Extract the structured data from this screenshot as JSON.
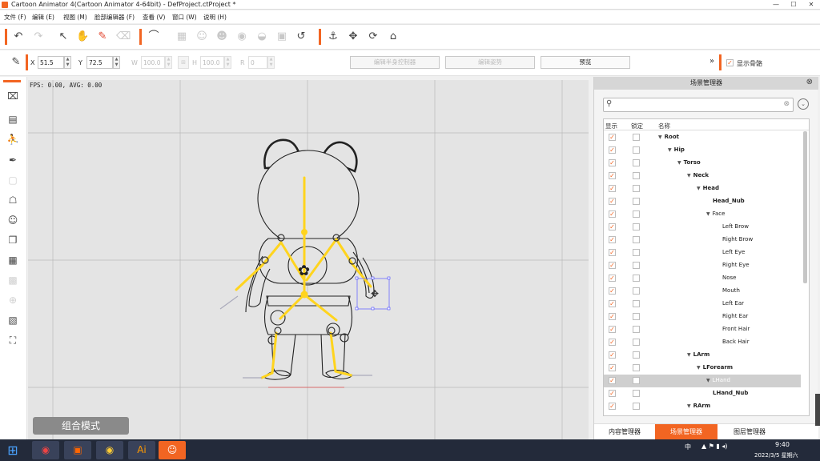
{
  "window": {
    "title": "Cartoon Animator 4(Cartoon Animator 4-64bit) - DefProject.ctProject *",
    "minimize": "—",
    "maximize": "☐",
    "close": "✕"
  },
  "menu": [
    "文件 (F)",
    "编辑 (E)",
    "视图 (M)",
    "脸部编辑器 (F)",
    "查看 (V)",
    "窗口 (W)",
    "说明 (H)"
  ],
  "toolbar2": {
    "x_label": "X",
    "x_value": "51.5",
    "y_label": "Y",
    "y_value": "72.5",
    "w_label": "W",
    "w_value": "100.0",
    "h_label": "H",
    "h_value": "100.0",
    "r_label": "R",
    "r_value": "0",
    "btn_edit_sprite": "编辑半身控制器",
    "btn_edit_pose": "编辑姿势",
    "btn_preview": "预览",
    "more": "»",
    "show_bones_label": "显示骨骼",
    "show_bones_checked": true
  },
  "viewport": {
    "fps_text": "FPS: 0.00, AVG: 0.00",
    "mode_button": "组合模式"
  },
  "scene_panel": {
    "title": "场景管理器",
    "search_placeholder": "",
    "col_show": "显示",
    "col_lock": "锁定",
    "col_name": "名称",
    "rows": [
      {
        "name": "Root",
        "depth": 0,
        "expanded": true,
        "bold": true
      },
      {
        "name": "Hip",
        "depth": 1,
        "expanded": true,
        "bold": true
      },
      {
        "name": "Torso",
        "depth": 2,
        "expanded": true,
        "bold": true
      },
      {
        "name": "Neck",
        "depth": 3,
        "expanded": true,
        "bold": true
      },
      {
        "name": "Head",
        "depth": 4,
        "expanded": true,
        "bold": true
      },
      {
        "name": "Head_Nub",
        "depth": 5,
        "expanded": false,
        "bold": true
      },
      {
        "name": "Face",
        "depth": 5,
        "expanded": true,
        "bold": false
      },
      {
        "name": "Left Brow",
        "depth": 6,
        "expanded": false,
        "bold": false
      },
      {
        "name": "Right Brow",
        "depth": 6,
        "expanded": false,
        "bold": false
      },
      {
        "name": "Left Eye",
        "depth": 6,
        "expanded": false,
        "bold": false
      },
      {
        "name": "Right Eye",
        "depth": 6,
        "expanded": false,
        "bold": false
      },
      {
        "name": "Nose",
        "depth": 6,
        "expanded": false,
        "bold": false
      },
      {
        "name": "Mouth",
        "depth": 6,
        "expanded": false,
        "bold": false
      },
      {
        "name": "Left Ear",
        "depth": 6,
        "expanded": false,
        "bold": false
      },
      {
        "name": "Right Ear",
        "depth": 6,
        "expanded": false,
        "bold": false
      },
      {
        "name": "Front Hair",
        "depth": 6,
        "expanded": false,
        "bold": false
      },
      {
        "name": "Back Hair",
        "depth": 6,
        "expanded": false,
        "bold": false
      },
      {
        "name": "LArm",
        "depth": 3,
        "expanded": true,
        "bold": true
      },
      {
        "name": "LForearm",
        "depth": 4,
        "expanded": true,
        "bold": true
      },
      {
        "name": "LHand",
        "depth": 5,
        "expanded": true,
        "bold": false,
        "selected": true
      },
      {
        "name": "LHand_Nub",
        "depth": 5,
        "expanded": false,
        "bold": true
      },
      {
        "name": "RArm",
        "depth": 3,
        "expanded": true,
        "bold": true
      }
    ],
    "tabs": [
      "内容管理器",
      "场景管理器",
      "图层管理器"
    ],
    "active_tab": 1
  },
  "taskbar": {
    "time": "9:40",
    "date": "2022/3/5 星期六",
    "ime": "中"
  },
  "colors": {
    "accent": "#f26522",
    "bone": "#ffd41e",
    "taskbar": "#232a3a"
  }
}
